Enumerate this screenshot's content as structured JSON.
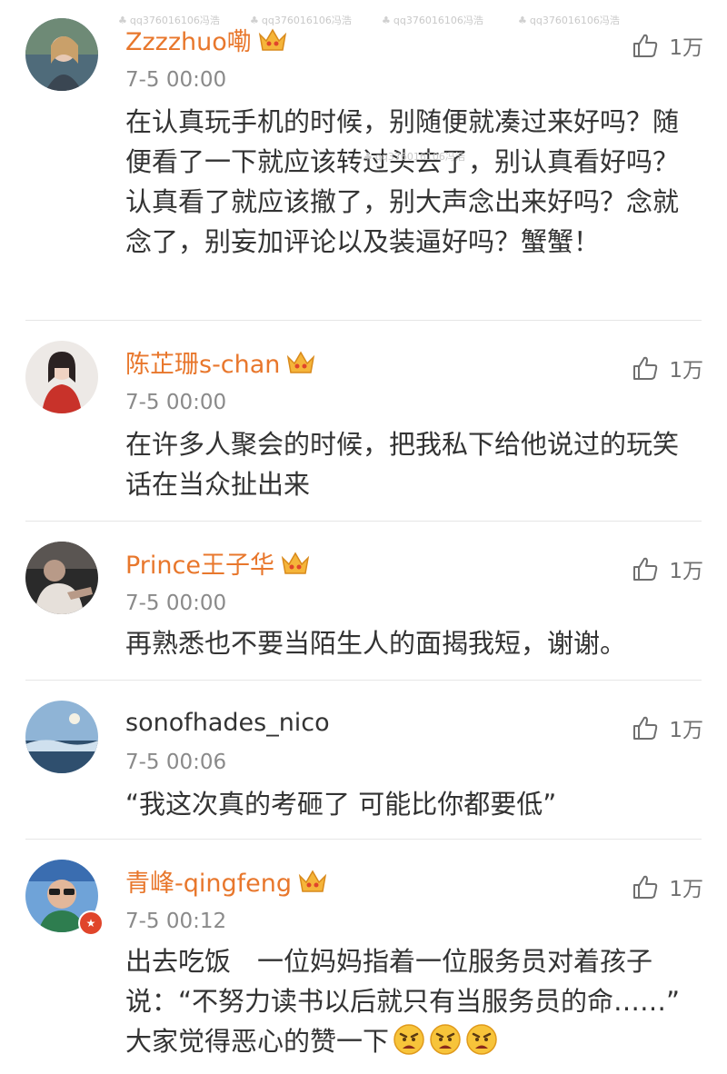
{
  "watermark": "qq376016106冯浩",
  "colors": {
    "vip_name": "#e8772c",
    "plain_name": "#333333",
    "time": "#8a8a8a",
    "divider": "#e6e6e6"
  },
  "comments": [
    {
      "username": "Zzzzhuo嘞",
      "time": "7-5 00:00",
      "likes": "1万",
      "text": "在认真玩手机的时候，别随便就凑过来好吗？随便看了一下就应该转过头去了，别认真看好吗？认真看了就应该撤了，别大声念出来好吗？念就念了，别妄加评论以及装逼好吗？蟹蟹！"
    },
    {
      "username": "陈芷珊s-chan",
      "time": "7-5 00:00",
      "likes": "1万",
      "text": "在许多人聚会的时候，把我私下给他说过的玩笑话在当众扯出来"
    },
    {
      "username": "Prince王子华",
      "time": "7-5 00:00",
      "likes": "1万",
      "text": "再熟悉也不要当陌生人的面揭我短，谢谢。"
    },
    {
      "username": "sonofhades_nico",
      "time": "7-5 00:06",
      "likes": "1万",
      "text": "“我这次真的考砸了 可能比你都要低”"
    },
    {
      "username": "青峰-qingfeng",
      "time": "7-5 00:12",
      "likes": "1万",
      "text": "出去吃饭　一位妈妈指着一位服务员对着孩子说：“不努力读书以后就只有当服务员的命……”　大家觉得恶心的赞一下"
    }
  ]
}
